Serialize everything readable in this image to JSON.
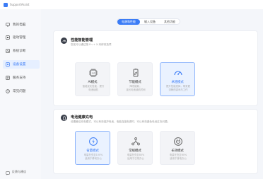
{
  "app": {
    "title": "SupportAssist"
  },
  "sidebar": {
    "items": [
      {
        "label": "我的电脑",
        "icon": "computer-icon"
      },
      {
        "label": "驱动管理",
        "icon": "driver-icon"
      },
      {
        "label": "系统诊断",
        "icon": "diagnose-icon"
      },
      {
        "label": "设备设置",
        "icon": "device-settings-icon",
        "active": true
      },
      {
        "label": "服务支持",
        "icon": "service-icon"
      },
      {
        "label": "常见问题",
        "icon": "faq-icon"
      }
    ],
    "feedback_label": "反馈与建议"
  },
  "tabs": [
    {
      "label": "电源和性能",
      "active": true
    },
    {
      "label": "输入设备",
      "active": false
    },
    {
      "label": "其他功能",
      "active": false
    }
  ],
  "performance": {
    "title": "性能智能管理",
    "desc": "您还可以通过按 Fn + X 来修改选项",
    "modes": [
      {
        "name": "AI模式",
        "desc1": "智能优化性能，提升",
        "desc2": "电池续航",
        "selected": false,
        "icon": "ai-chip-icon"
      },
      {
        "name": "节能模式",
        "desc1": "降低能耗，",
        "desc2": "延长电池续航时间",
        "selected": false,
        "icon": "battery-leaf-icon"
      },
      {
        "name": "卓越模式",
        "desc1": "提升性能发挥，带来更",
        "desc2": "流畅的游戏与工作",
        "selected": true,
        "icon": "speedometer-icon"
      }
    ]
  },
  "battery": {
    "title": "电池健康充电",
    "desc": "设置最佳充电模式，可以有效保护电池，电脑连接电源时，可以有效避免电池过充问题。",
    "modes": [
      {
        "name": "省量模式",
        "desc1": "电量在充至100%",
        "desc2": "适用于移动办公",
        "selected": true,
        "icon": "battery-bolt-icon"
      },
      {
        "name": "常规模式",
        "desc1": "电量在充至80%",
        "desc2": "适用于日常办公",
        "selected": false,
        "icon": "balance-icon"
      },
      {
        "name": "长效模式",
        "desc1": "电量在充至60%",
        "desc2": "适用于接电办公",
        "selected": false,
        "icon": "power-plug-icon"
      }
    ]
  },
  "colors": {
    "accent": "#3b7cf6",
    "selected_bg": "#eaf2ff",
    "background": "#f4f6fa"
  }
}
